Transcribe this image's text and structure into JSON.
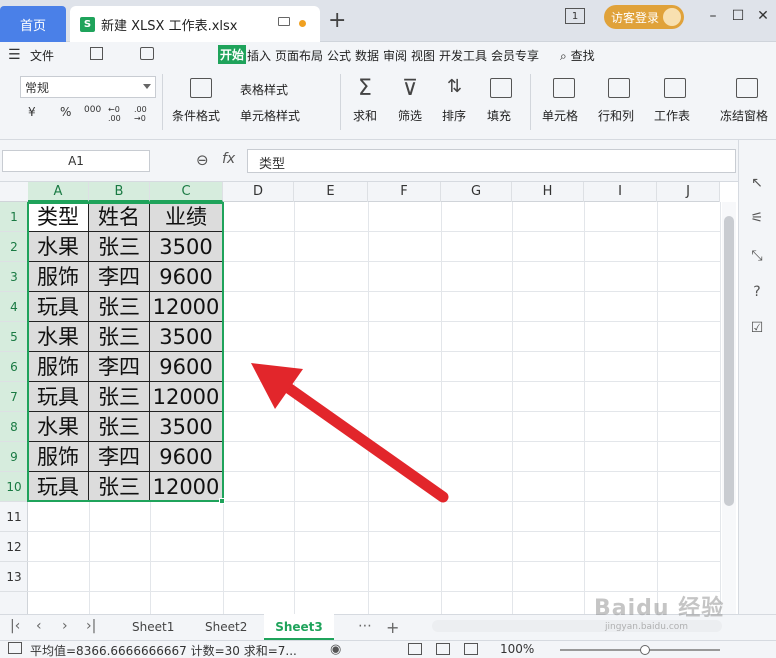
{
  "titlebar": {
    "home_tab": "首页",
    "doc_tab": "新建 XLSX 工作表.xlsx",
    "logo_letter": "S",
    "plus": "+",
    "window_count": "1",
    "guest_login": "访客登录"
  },
  "menubar": {
    "file": "文件",
    "items": [
      "开始",
      "插入",
      "页面布局",
      "公式",
      "数据",
      "审阅",
      "视图",
      "开发工具",
      "会员专享"
    ],
    "search": "查找"
  },
  "toolbar": {
    "number_format": "常规",
    "number_buttons": [
      "¥",
      "%",
      "000",
      "←0 .00",
      ".00 →0"
    ],
    "conditional_format": "条件格式",
    "table_style": "表格样式",
    "cell_style": "单元格样式",
    "sum": "求和",
    "filter": "筛选",
    "sort": "排序",
    "fill": "填充",
    "cell": "单元格",
    "row_col": "行和列",
    "worksheet": "工作表",
    "freeze": "冻结窗格"
  },
  "formula_bar": {
    "name_box": "A1",
    "fx": "fx",
    "value": "类型"
  },
  "columns": [
    "A",
    "B",
    "C",
    "D",
    "E",
    "F",
    "G",
    "H",
    "I",
    "J"
  ],
  "rows": [
    "1",
    "2",
    "3",
    "4",
    "5",
    "6",
    "7",
    "8",
    "9",
    "10",
    "11",
    "12",
    "13"
  ],
  "table": [
    [
      "类型",
      "姓名",
      "业绩"
    ],
    [
      "水果",
      "张三",
      "3500"
    ],
    [
      "服饰",
      "李四",
      "9600"
    ],
    [
      "玩具",
      "张三",
      "12000"
    ],
    [
      "水果",
      "张三",
      "3500"
    ],
    [
      "服饰",
      "李四",
      "9600"
    ],
    [
      "玩具",
      "张三",
      "12000"
    ],
    [
      "水果",
      "张三",
      "3500"
    ],
    [
      "服饰",
      "李四",
      "9600"
    ],
    [
      "玩具",
      "张三",
      "12000"
    ]
  ],
  "sheets": [
    "Sheet1",
    "Sheet2",
    "Sheet3"
  ],
  "active_sheet": "Sheet3",
  "status": {
    "summary": "平均值=8366.6666666667  计数=30  求和=7...",
    "zoom": "100%"
  },
  "watermark": {
    "main": "Baidu 经验",
    "sub": "jingyan.baidu.com"
  },
  "colors": {
    "accent": "#1fa35b",
    "home_tab": "#4a80e8",
    "arrow": "#e2262b",
    "guest": "#e0a23a"
  }
}
